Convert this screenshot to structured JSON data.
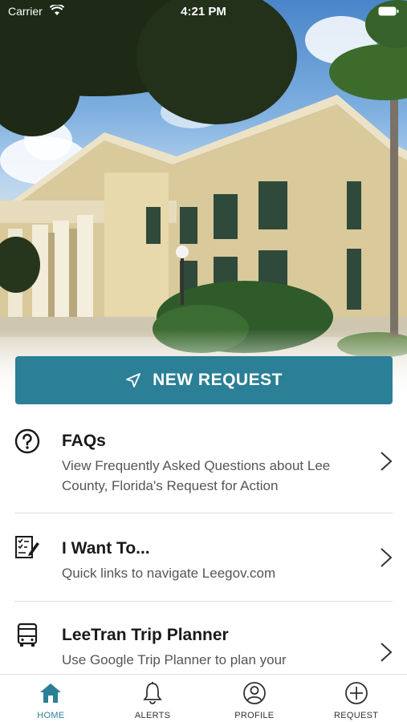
{
  "status_bar": {
    "carrier": "Carrier",
    "time": "4:21 PM"
  },
  "hero": {
    "image": "county-courthouse-photo"
  },
  "new_request": {
    "label": "NEW REQUEST",
    "icon": "send-icon"
  },
  "list": {
    "items": [
      {
        "icon": "question-circle-icon",
        "title": "FAQs",
        "description": "View Frequently Asked Questions about Lee County, Florida's Request for Action"
      },
      {
        "icon": "checklist-pencil-icon",
        "title": "I Want To...",
        "description": "Quick links to navigate Leegov.com"
      },
      {
        "icon": "bus-icon",
        "title": "LeeTran Trip Planner",
        "description": "Use Google Trip Planner to plan your"
      }
    ]
  },
  "tab_bar": {
    "tabs": [
      {
        "label": "HOME",
        "icon": "home-icon",
        "active": true
      },
      {
        "label": "ALERTS",
        "icon": "bell-icon",
        "active": false
      },
      {
        "label": "PROFILE",
        "icon": "user-circle-icon",
        "active": false
      },
      {
        "label": "REQUEST",
        "icon": "plus-circle-icon",
        "active": false
      }
    ]
  },
  "colors": {
    "accent": "#2b7f96",
    "divider": "#dddddd",
    "description_text": "#555555"
  }
}
